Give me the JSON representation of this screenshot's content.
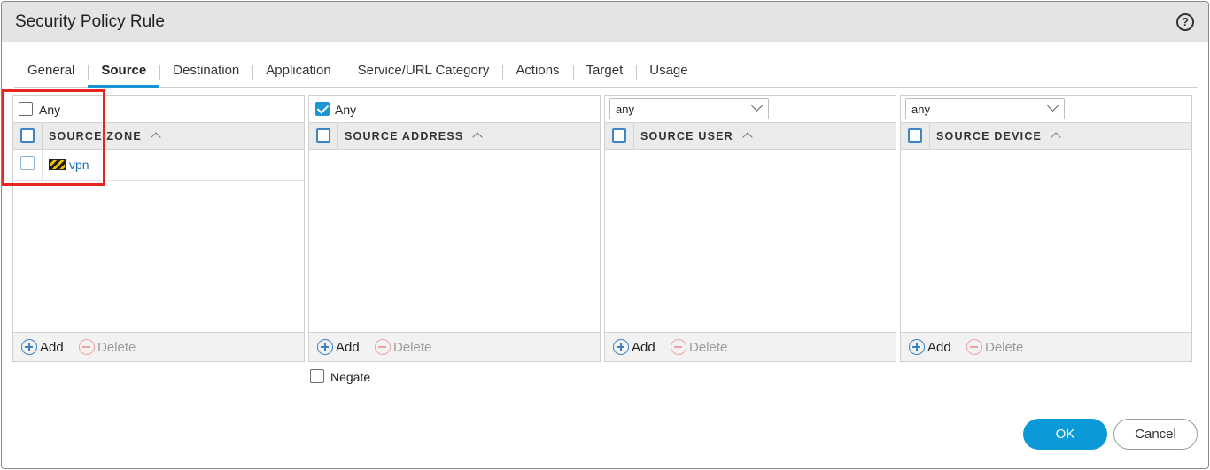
{
  "dialog": {
    "title": "Security Policy Rule",
    "help_glyph": "?"
  },
  "tabs": [
    {
      "label": "General"
    },
    {
      "label": "Source"
    },
    {
      "label": "Destination"
    },
    {
      "label": "Application"
    },
    {
      "label": "Service/URL Category"
    },
    {
      "label": "Actions"
    },
    {
      "label": "Target"
    },
    {
      "label": "Usage"
    }
  ],
  "active_tab": "Source",
  "source_zone": {
    "any_label": "Any",
    "any_checked": false,
    "column_header": "SOURCE ZONE",
    "rows": [
      {
        "name": "vpn",
        "icon": "zone-icon"
      }
    ],
    "add_label": "Add",
    "delete_label": "Delete"
  },
  "source_address": {
    "any_label": "Any",
    "any_checked": true,
    "column_header": "SOURCE ADDRESS",
    "add_label": "Add",
    "delete_label": "Delete",
    "negate_label": "Negate",
    "negate_checked": false
  },
  "source_user": {
    "select_value": "any",
    "column_header": "SOURCE USER",
    "add_label": "Add",
    "delete_label": "Delete"
  },
  "source_device": {
    "select_value": "any",
    "column_header": "SOURCE DEVICE",
    "add_label": "Add",
    "delete_label": "Delete"
  },
  "footer": {
    "ok_label": "OK",
    "cancel_label": "Cancel"
  },
  "colors": {
    "accent": "#1a96d4",
    "ok_button": "#0b99d8",
    "highlight": "#e5251e",
    "link": "#1a75b8"
  }
}
